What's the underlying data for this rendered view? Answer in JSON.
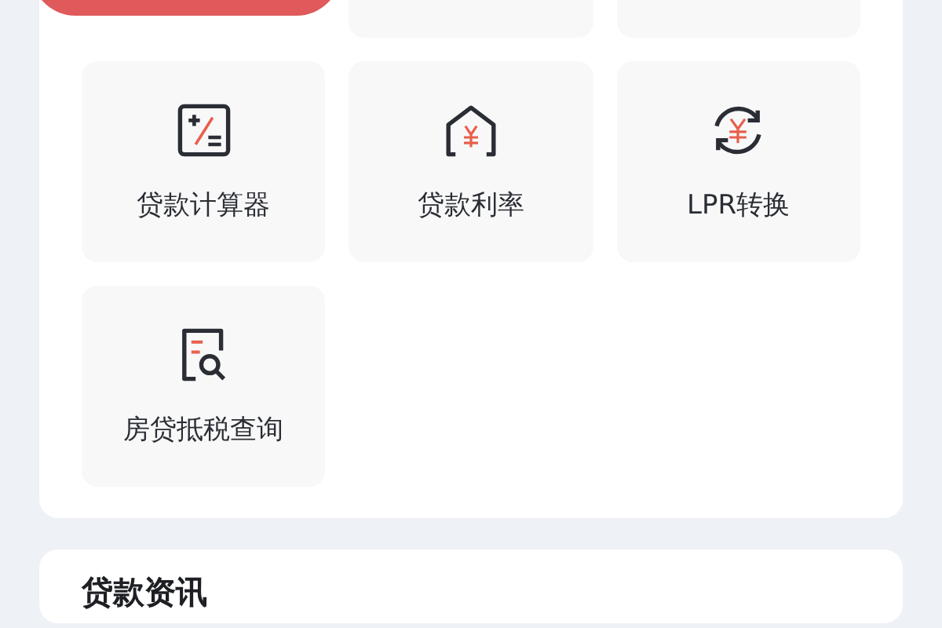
{
  "tools": [
    {
      "kind": "calculator",
      "label": "贷款计算器"
    },
    {
      "kind": "house",
      "label": "贷款利率"
    },
    {
      "kind": "exchange",
      "label": "LPR转换"
    },
    {
      "kind": "search",
      "label": "房贷抵税查询"
    }
  ],
  "news": {
    "title": "贷款资讯"
  }
}
